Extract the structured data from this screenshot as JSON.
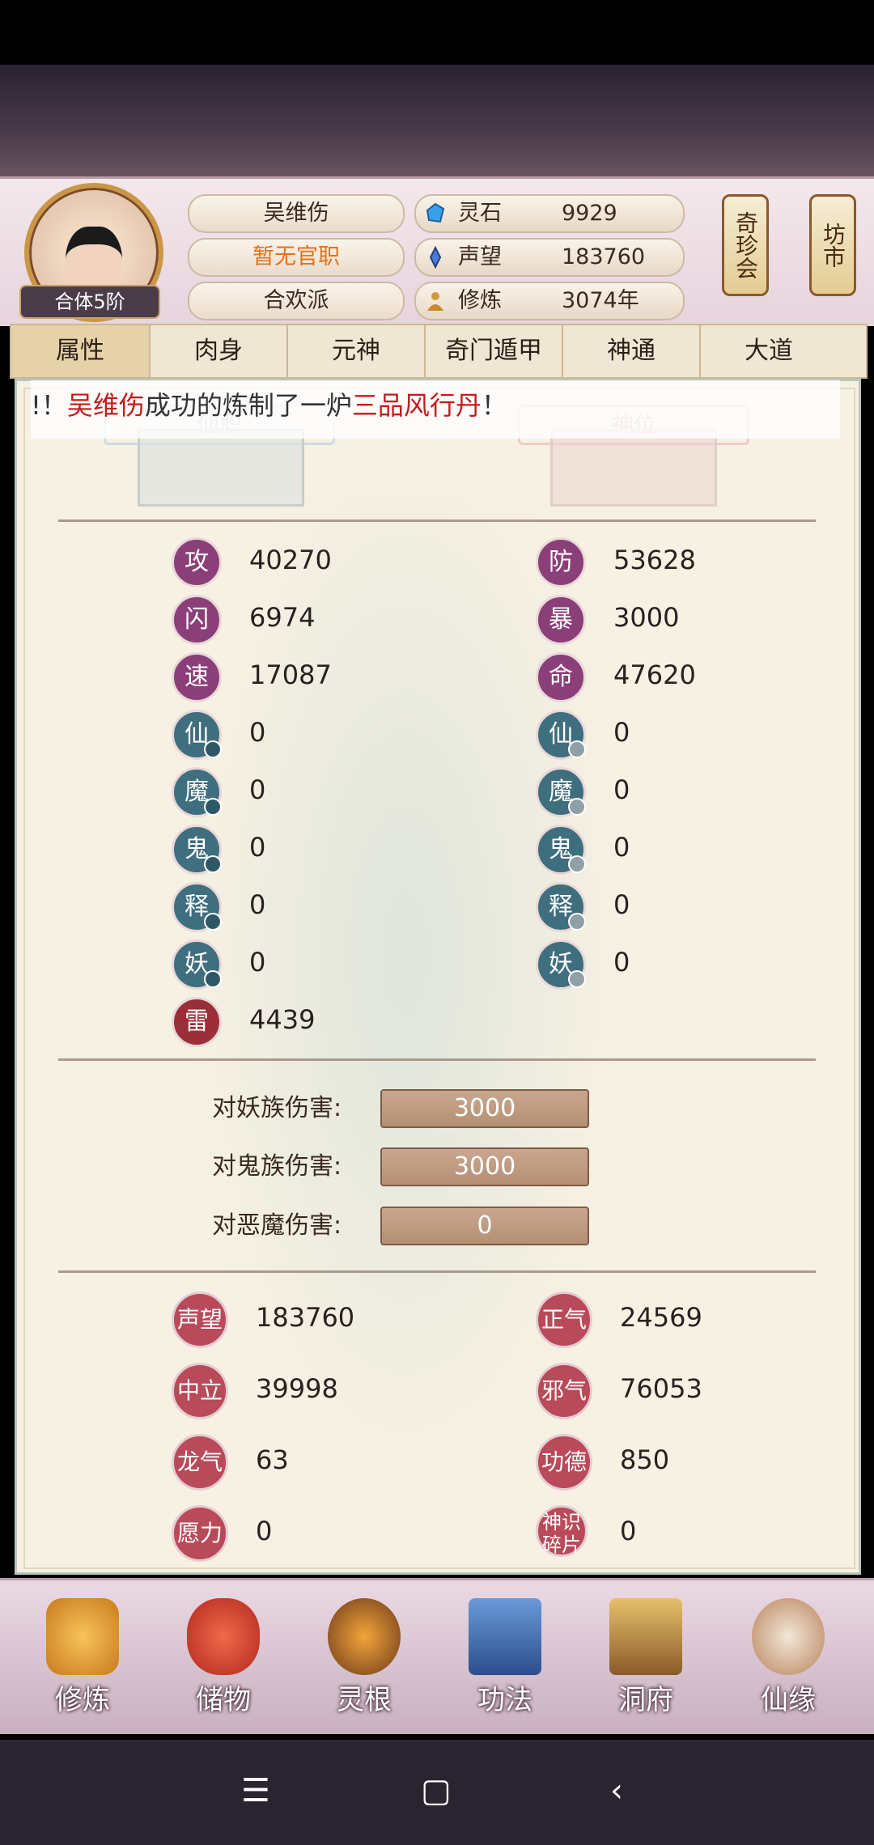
{
  "player": {
    "name": "吴维伤",
    "office": "暂无官职",
    "sect": "合欢派",
    "rank": "合体5阶"
  },
  "resources": [
    {
      "label": "灵石",
      "value": "9929",
      "icon": "spirit-stone-icon"
    },
    {
      "label": "声望",
      "value": "183760",
      "icon": "reputation-icon"
    },
    {
      "label": "修炼",
      "value": "3074年",
      "icon": "cultivation-icon"
    }
  ],
  "lanterns": [
    "奇珍会",
    "坊市"
  ],
  "tabs": [
    "属性",
    "肉身",
    "元神",
    "奇门遁甲",
    "神通",
    "大道"
  ],
  "ticker": {
    "prefix": "!！",
    "name": "吴维伤",
    "middle": "成功的炼制了一炉",
    "item": "三品风行丹",
    "suffix": "！"
  },
  "slots": {
    "left": "仙职",
    "right": "神位"
  },
  "stats_left": [
    {
      "badge": "攻",
      "value": "40270"
    },
    {
      "badge": "闪",
      "value": "6974"
    },
    {
      "badge": "速",
      "value": "17087"
    },
    {
      "badge": "仙",
      "value": "0"
    },
    {
      "badge": "魔",
      "value": "0"
    },
    {
      "badge": "鬼",
      "value": "0"
    },
    {
      "badge": "释",
      "value": "0"
    },
    {
      "badge": "妖",
      "value": "0"
    },
    {
      "badge": "雷",
      "value": "4439"
    }
  ],
  "stats_right": [
    {
      "badge": "防",
      "value": "53628"
    },
    {
      "badge": "暴",
      "value": "3000"
    },
    {
      "badge": "命",
      "value": "47620"
    },
    {
      "badge": "仙",
      "value": "0"
    },
    {
      "badge": "魔",
      "value": "0"
    },
    {
      "badge": "鬼",
      "value": "0"
    },
    {
      "badge": "释",
      "value": "0"
    },
    {
      "badge": "妖",
      "value": "0"
    }
  ],
  "damage": [
    {
      "label": "对妖族伤害:",
      "value": "3000"
    },
    {
      "label": "对鬼族伤害:",
      "value": "3000"
    },
    {
      "label": "对恶魔伤害:",
      "value": "0"
    }
  ],
  "misc_left": [
    {
      "badge": "声望",
      "value": "183760"
    },
    {
      "badge": "中立",
      "value": "39998"
    },
    {
      "badge": "龙气",
      "value": "63"
    },
    {
      "badge": "愿力",
      "value": "0"
    }
  ],
  "misc_right": [
    {
      "badge": "正气",
      "value": "24569"
    },
    {
      "badge": "邪气",
      "value": "76053"
    },
    {
      "badge": "功德",
      "value": "850"
    },
    {
      "badge": "神识碎片",
      "value": "0"
    }
  ],
  "nav": [
    "修炼",
    "储物",
    "灵根",
    "功法",
    "洞府",
    "仙缘"
  ],
  "colors": {
    "accent": "#c31b1b",
    "office": "#e0731a",
    "panel": "#f7f1e3"
  }
}
